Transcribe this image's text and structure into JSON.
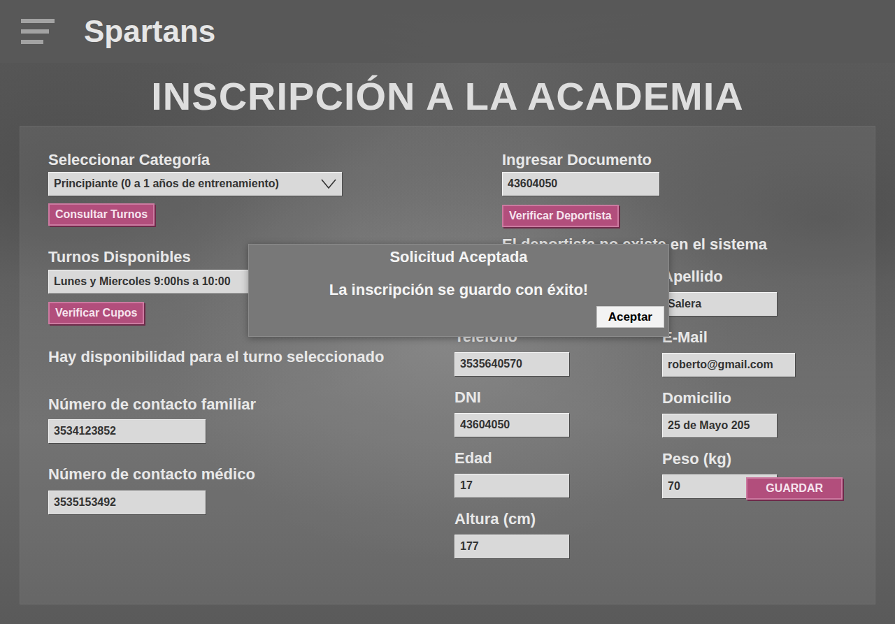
{
  "app": {
    "title": "Spartans"
  },
  "page_title": "INSCRIPCIÓN A LA ACADEMIA",
  "form": {
    "category": {
      "label": "Seleccionar Categoría",
      "value": "Principiante (0 a 1 años de entrenamiento)",
      "button": "Consultar Turnos"
    },
    "shift": {
      "label": "Turnos Disponibles",
      "value": "Lunes y Miercoles 9:00hs a 10:00",
      "button": "Verificar Cupos",
      "message": "Hay disponibilidad para el turno seleccionado"
    },
    "contacts": [
      {
        "label": "Número de contacto familiar",
        "value": "3534123852"
      },
      {
        "label": "Número de contacto médico",
        "value": "3535153492"
      }
    ],
    "document": {
      "label": "Ingresar Documento",
      "value": "43604050",
      "button": "Verificar Deportista",
      "message": "El deportista no existe en el sistema"
    },
    "fields": {
      "left": [
        {
          "label": "Telefono",
          "value": "3535640570"
        },
        {
          "label": "DNI",
          "value": "43604050"
        },
        {
          "label": "Edad",
          "value": "17"
        },
        {
          "label": "Altura (cm)",
          "value": "177"
        }
      ],
      "right": [
        {
          "label": "Apellido",
          "value": "Salera"
        },
        {
          "label": "E-Mail",
          "value": "roberto@gmail.com"
        },
        {
          "label": "Domicilio",
          "value": "25 de Mayo 205"
        },
        {
          "label": "Peso (kg)",
          "value": "70"
        }
      ]
    },
    "save_button": "GUARDAR"
  },
  "dialog": {
    "title": "Solicitud Aceptada",
    "message": "La inscripción se guardo con éxito!",
    "button": "Aceptar"
  }
}
